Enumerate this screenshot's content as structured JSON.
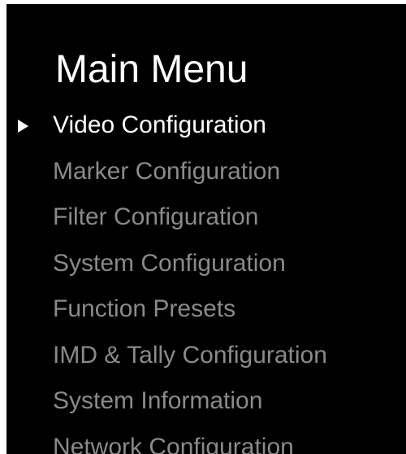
{
  "menu": {
    "title": "Main Menu",
    "selected_index": 0,
    "items": [
      {
        "label": "Video Configuration",
        "state": "selected"
      },
      {
        "label": "Marker Configuration",
        "state": "normal"
      },
      {
        "label": "Filter Configuration",
        "state": "normal"
      },
      {
        "label": "System Configuration",
        "state": "normal"
      },
      {
        "label": "Function Presets",
        "state": "normal"
      },
      {
        "label": "IMD & Tally Configuration",
        "state": "normal"
      },
      {
        "label": "System Information",
        "state": "normal"
      },
      {
        "label": "Network Configuration",
        "state": "normal"
      }
    ]
  },
  "icons": {
    "cursor": "play-triangle-right-icon"
  },
  "colors": {
    "background": "#000000",
    "title": "#ffffff",
    "selected_item": "#ffffff",
    "unselected_item": "#8a8a8a",
    "outer_frame": "#ffffff"
  }
}
